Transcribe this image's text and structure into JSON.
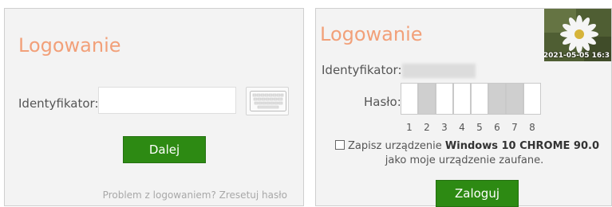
{
  "left": {
    "title": "Logowanie",
    "identifier_label": "Identyfikator:",
    "identifier_value": "",
    "identifier_placeholder": "",
    "next_label": "Dalej",
    "reset_link": "Problem z logowaniem? Zresetuj hasło"
  },
  "right": {
    "title": "Logowanie",
    "identifier_label": "Identyfikator:",
    "password_label": "Hasło:",
    "pin_positions": [
      "1",
      "2",
      "3",
      "4",
      "5",
      "6",
      "7",
      "8"
    ],
    "remember_prefix": "Zapisz urządzenie",
    "device_name": "Windows 10 CHROME 90.0",
    "remember_suffix": "jako moje urządzenie zaufane.",
    "login_label": "Zaloguj",
    "photo_timestamp": "2021-05-05 16:3"
  },
  "colors": {
    "title": "#f2a079",
    "button": "#2d8a13",
    "panel": "#f3f3f3"
  },
  "icons": {
    "keyboard": "keyboard-icon",
    "photo": "flower-photo"
  }
}
